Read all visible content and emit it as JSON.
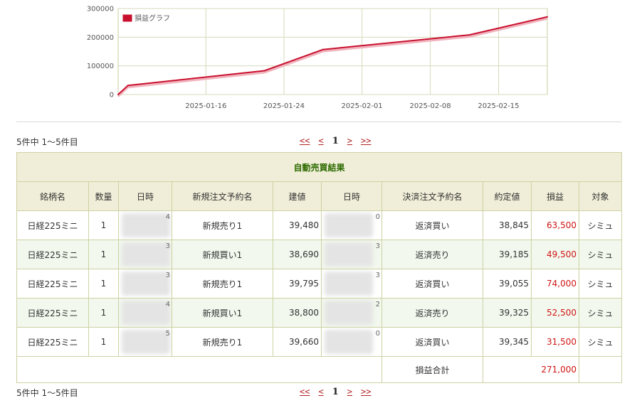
{
  "chart_data": {
    "type": "line",
    "legend": "損益グラフ",
    "legend_placement": "top-left",
    "color": "#c8102e",
    "grid": true,
    "ylim": [
      0,
      300000
    ],
    "yticks": [
      "300000",
      "200000",
      "100000",
      "0"
    ],
    "xticks": [
      "2025-01-16",
      "2025-01-24",
      "2025-02-01",
      "2025-02-08",
      "2025-02-15"
    ],
    "xlim": [
      "2025-01-07",
      "2025-02-20"
    ],
    "series": [
      {
        "name": "損益グラフ",
        "x": [
          "2025-01-07",
          "2025-01-08",
          "2025-01-22",
          "2025-01-28",
          "2025-02-12",
          "2025-02-20"
        ],
        "y": [
          0,
          31500,
          83000,
          157000,
          208000,
          271000
        ]
      }
    ]
  },
  "pager": {
    "summary": "5件中 1〜5件目",
    "first": "<<",
    "prev": "<",
    "current": "1",
    "next": ">",
    "last": ">>"
  },
  "table": {
    "caption": "自動売買結果",
    "headers": [
      "銘柄名",
      "数量",
      "日時",
      "新規注文予約名",
      "建値",
      "日時",
      "決済注文予約名",
      "約定値",
      "損益",
      "対象"
    ],
    "rows": [
      {
        "name": "日経225ミニ",
        "qty": "1",
        "open_tail": "4",
        "open_order": "新規売り1",
        "open_price": "39,480",
        "close_tail": "0",
        "close_order": "返済買い",
        "close_price": "38,845",
        "pl": "63,500",
        "target": "シミュ"
      },
      {
        "name": "日経225ミニ",
        "qty": "1",
        "open_tail": "3",
        "open_order": "新規買い1",
        "open_price": "38,690",
        "close_tail": "3",
        "close_order": "返済売り",
        "close_price": "39,185",
        "pl": "49,500",
        "target": "シミュ"
      },
      {
        "name": "日経225ミニ",
        "qty": "1",
        "open_tail": "3",
        "open_order": "新規売り1",
        "open_price": "39,795",
        "close_tail": "3",
        "close_order": "返済買い",
        "close_price": "39,055",
        "pl": "74,000",
        "target": "シミュ"
      },
      {
        "name": "日経225ミニ",
        "qty": "1",
        "open_tail": "4",
        "open_order": "新規買い1",
        "open_price": "38,800",
        "close_tail": "2",
        "close_order": "返済売り",
        "close_price": "39,325",
        "pl": "52,500",
        "target": "シミュ"
      },
      {
        "name": "日経225ミニ",
        "qty": "1",
        "open_tail": "5",
        "open_order": "新規売り1",
        "open_price": "39,660",
        "close_tail": "0",
        "close_order": "返済買い",
        "close_price": "39,345",
        "pl": "31,500",
        "target": "シミュ"
      }
    ],
    "total_label": "損益合計",
    "total_value": "271,000"
  }
}
